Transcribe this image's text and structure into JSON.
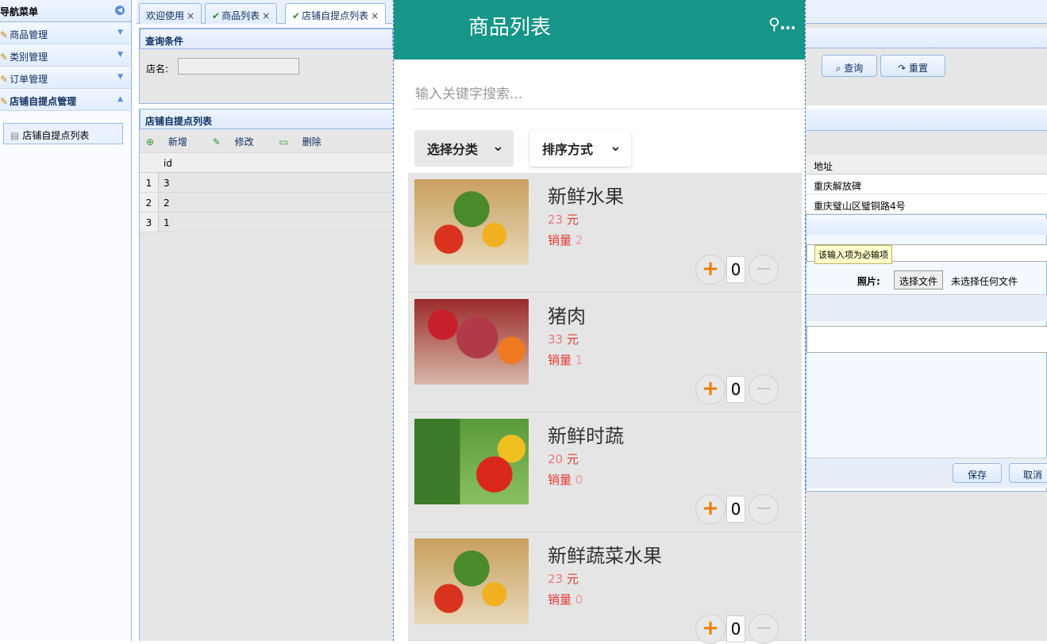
{
  "nav": {
    "title": "导航菜单",
    "groups": [
      "商品管理",
      "类别管理",
      "订单管理",
      "店铺自提点管理"
    ],
    "active_item": "店铺自提点列表"
  },
  "tabs": [
    {
      "label": "欢迎使用"
    },
    {
      "label": "商品列表"
    },
    {
      "label": "店铺自提点列表"
    }
  ],
  "query": {
    "title": "查询条件",
    "field_label": "店名:",
    "search_label": "查询",
    "reset_label": "重置"
  },
  "list": {
    "title": "店铺自提点列表",
    "toolbar": {
      "add": "新增",
      "edit": "修改",
      "delete": "删除"
    },
    "columns": [
      "id",
      "地址"
    ],
    "rows": [
      {
        "num": "1",
        "id": "3",
        "address": "重庆解放碑"
      },
      {
        "num": "2",
        "id": "2",
        "address": "重庆璧山区璧铜路4号"
      },
      {
        "num": "3",
        "id": "1",
        "address": ""
      }
    ]
  },
  "form": {
    "tooltip": "该输入项为必输项",
    "photo_label": "照片:",
    "file_button": "选择文件",
    "file_status": "未选择任何文件",
    "save_label": "保存",
    "cancel_label": "取消"
  },
  "phone": {
    "title": "商品列表",
    "menu_glyph": "…",
    "search_placeholder": "输入关键字搜索...",
    "filter_category": "选择分类",
    "filter_sort": "排序方式",
    "price_unit": "元",
    "sales_label": "销量",
    "items": [
      {
        "name": "新鲜水果",
        "price": "23",
        "sales": "2",
        "qty": "0"
      },
      {
        "name": "猪肉",
        "price": "33",
        "sales": "1",
        "qty": "0"
      },
      {
        "name": "新鲜时蔬",
        "price": "20",
        "sales": "0",
        "qty": "0"
      },
      {
        "name": "新鲜蔬菜水果",
        "price": "23",
        "sales": "0",
        "qty": "0"
      }
    ]
  },
  "colors": {
    "brand": "#159688",
    "accent": "#f07c00",
    "price": "#e53935",
    "panel_border": "#95b8e7"
  }
}
